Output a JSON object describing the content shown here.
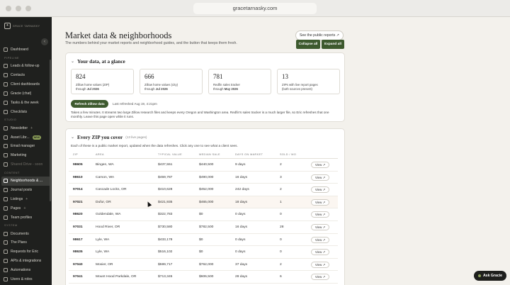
{
  "browser": {
    "url": "gracetarnasky.com"
  },
  "sidebar": {
    "brand": "GRACE TARNASKY",
    "sections": [
      {
        "key": "top",
        "items": [
          {
            "label": "Dashboard"
          }
        ]
      },
      {
        "key": "pipeline",
        "title": "PIPELINE",
        "items": [
          {
            "label": "Leads & follow-up"
          },
          {
            "label": "Contacts"
          },
          {
            "label": "Client dashboards"
          },
          {
            "label": "Gracie (chat)"
          },
          {
            "label": "Tasks & the week"
          },
          {
            "label": "Checklists"
          }
        ]
      },
      {
        "key": "studio",
        "title": "STUDIO",
        "items": [
          {
            "label": "Newsletter",
            "plus": "+"
          },
          {
            "label": "Asset Libr...",
            "badge": "NEW"
          },
          {
            "label": "Email manager"
          },
          {
            "label": "Marketing"
          },
          {
            "label": "Shared Drive - soon"
          }
        ]
      },
      {
        "key": "content",
        "title": "CONTENT",
        "items": [
          {
            "label": "Neighborhoods & ..."
          },
          {
            "label": "Journal posts"
          },
          {
            "label": "Listings",
            "plus": "+"
          },
          {
            "label": "Pages",
            "plus": "+"
          },
          {
            "label": "Team profiles"
          }
        ]
      },
      {
        "key": "system",
        "title": "SYSTEM",
        "items": [
          {
            "label": "Documents"
          },
          {
            "label": "The Plans"
          },
          {
            "label": "Requests for Eric"
          },
          {
            "label": "APIs & integrations"
          },
          {
            "label": "Automations"
          },
          {
            "label": "Users & roles"
          }
        ]
      }
    ]
  },
  "header": {
    "title": "Market data & neighborhoods",
    "subtitle": "The numbers behind your market reports and neighborhood guides, and the button that keeps them fresh.",
    "public_button": "See the public reports ↗",
    "collapse_all": "Collapse all",
    "expand_all": "Expand all"
  },
  "glance": {
    "title": "Your data, at a glance",
    "stats": [
      {
        "num": "824",
        "line1": "Zillow home values (ZIP)",
        "prefix": "through ",
        "bold": "Jul 2026"
      },
      {
        "num": "666",
        "line1": "Zillow home values (city)",
        "prefix": "through ",
        "bold": "Jul 2026"
      },
      {
        "num": "781",
        "line1": "Redfin sales tracker",
        "prefix": "through ",
        "bold": "May 2026"
      },
      {
        "num": "13",
        "line1": "ZIPs with live report pages",
        "prefix": "(both sources present)",
        "bold": ""
      }
    ],
    "refresh_button": "Refresh Zillow data",
    "last_refreshed": "Last refreshed Aug 19, 4:21pm",
    "help": "Takes a few minutes. It streams two large Zillow research files and keeps every Oregon and Washington area. Redfin's sales tracker is a much larger file, so Eric refreshes that one monthly. Leave this page open while it runs."
  },
  "zips": {
    "title": "Every ZIP you cover",
    "count": "(13 live pages)",
    "description": "Each of these is a public market report, updated when the data refreshes. Click any one to see what a client sees.",
    "columns": [
      "ZIP",
      "AREA",
      "TYPICAL VALUE",
      "MEDIAN SALE",
      "DAYS ON MARKET",
      "SOLD / MO"
    ],
    "view_label": "View ↗",
    "rows": [
      {
        "zip": "98605",
        "area": "Bingen, WA",
        "typical": "$437,551",
        "median": "$440,500",
        "days": "9 days",
        "sold": "2"
      },
      {
        "zip": "98610",
        "area": "Carson, WA",
        "typical": "$459,787",
        "median": "$490,000",
        "days": "16 days",
        "sold": "3"
      },
      {
        "zip": "97014",
        "area": "Cascade Locks, OR",
        "typical": "$410,628",
        "median": "$452,000",
        "days": "242 days",
        "sold": "2"
      },
      {
        "zip": "97021",
        "area": "Dufur, OR",
        "typical": "$421,935",
        "median": "$465,000",
        "days": "18 days",
        "sold": "1"
      },
      {
        "zip": "98620",
        "area": "Goldendale, WA",
        "typical": "$322,783",
        "median": "$0",
        "days": "0 days",
        "sold": "0"
      },
      {
        "zip": "97031",
        "area": "Hood River, OR",
        "typical": "$730,580",
        "median": "$782,500",
        "days": "16 days",
        "sold": "28"
      },
      {
        "zip": "98617",
        "area": "Lyle, WA",
        "typical": "$433,178",
        "median": "$0",
        "days": "0 days",
        "sold": "0"
      },
      {
        "zip": "98635",
        "area": "Lyle, WA",
        "typical": "$516,102",
        "median": "$0",
        "days": "0 days",
        "sold": "0"
      },
      {
        "zip": "97040",
        "area": "Mosier, OR",
        "typical": "$599,717",
        "median": "$762,000",
        "days": "37 days",
        "sold": "2"
      },
      {
        "zip": "97041",
        "area": "Mount Hood Parkdale, OR",
        "typical": "$713,345",
        "median": "$606,500",
        "days": "28 days",
        "sold": "6"
      }
    ]
  },
  "ask_button": "Ask Gracie"
}
